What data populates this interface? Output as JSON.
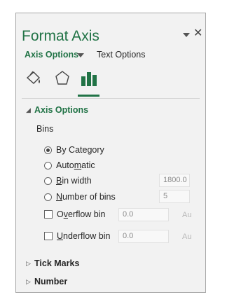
{
  "pane": {
    "title": "Format Axis",
    "subtabs": {
      "active": "Axis Options",
      "inactive": "Text Options"
    },
    "category_icons": [
      "fill-line-icon",
      "effects-icon",
      "axis-options-icon"
    ],
    "accent_color": "#217346"
  },
  "axis_options": {
    "section_label": "Axis Options",
    "bins_label": "Bins",
    "by_category": "By Category",
    "automatic": "Automatic",
    "bin_width": {
      "label": "Bin width",
      "value": "1800.0"
    },
    "number_of_bins": {
      "label": "Number of bins",
      "value": "5"
    },
    "overflow_bin": {
      "label": "Overflow bin",
      "value": "0.0",
      "auto": "Au"
    },
    "underflow_bin": {
      "label": "Underflow bin",
      "value": "0.0",
      "auto": "Au"
    }
  },
  "sections": {
    "tick_marks": "Tick Marks",
    "number": "Number"
  }
}
